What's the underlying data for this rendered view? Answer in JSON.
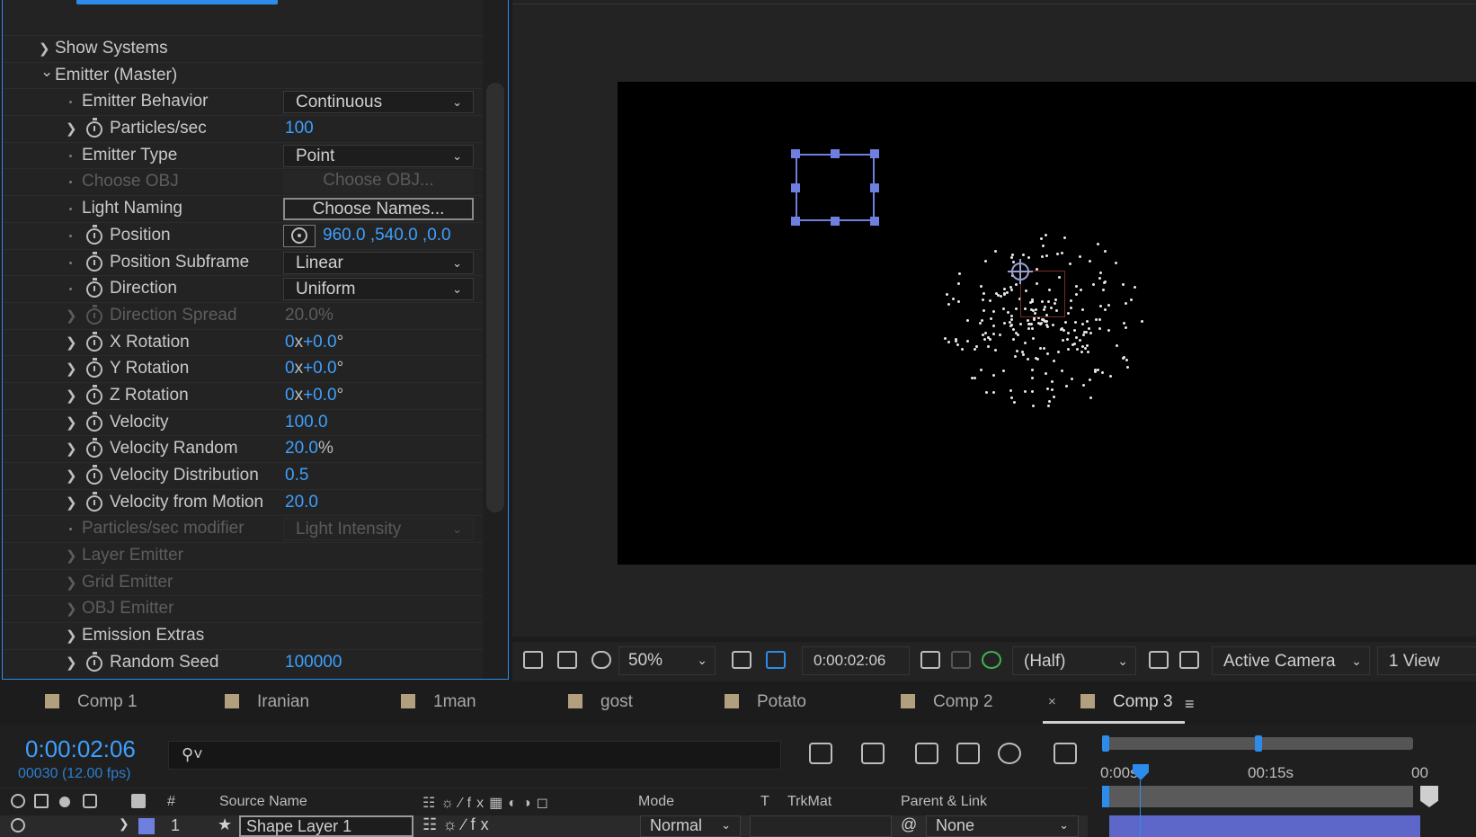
{
  "effect_controls": {
    "rows": [
      {
        "label": "Show Systems",
        "kind": "group",
        "expanded": false
      },
      {
        "label": "Emitter (Master)",
        "kind": "group",
        "expanded": true
      },
      {
        "label": "Emitter Behavior",
        "kind": "dropdown",
        "value": "Continuous"
      },
      {
        "label": "Particles/sec",
        "kind": "value",
        "value": "100",
        "twirl": true,
        "stopwatch": true
      },
      {
        "label": "Emitter Type",
        "kind": "dropdown",
        "value": "Point"
      },
      {
        "label": "Choose OBJ",
        "kind": "button",
        "value": "Choose OBJ...",
        "disabled": true
      },
      {
        "label": "Light Naming",
        "kind": "button",
        "value": "Choose Names..."
      },
      {
        "label": "Position",
        "kind": "point",
        "value": "960.0 ,540.0 ,0.0",
        "stopwatch": true
      },
      {
        "label": "Position Subframe",
        "kind": "dropdown",
        "value": "Linear",
        "stopwatch": true
      },
      {
        "label": "Direction",
        "kind": "dropdown",
        "value": "Uniform",
        "stopwatch": true
      },
      {
        "label": "Direction Spread",
        "kind": "value",
        "value": "20.0",
        "unit": "%",
        "twirl": true,
        "stopwatch": true,
        "disabled": true
      },
      {
        "label": "X Rotation",
        "kind": "rotation",
        "value": "0",
        "value2": "+0.0",
        "twirl": true,
        "stopwatch": true
      },
      {
        "label": "Y Rotation",
        "kind": "rotation",
        "value": "0",
        "value2": "+0.0",
        "twirl": true,
        "stopwatch": true
      },
      {
        "label": "Z Rotation",
        "kind": "rotation",
        "value": "0",
        "value2": "+0.0",
        "twirl": true,
        "stopwatch": true
      },
      {
        "label": "Velocity",
        "kind": "value",
        "value": "100.0",
        "twirl": true,
        "stopwatch": true
      },
      {
        "label": "Velocity Random",
        "kind": "value",
        "value": "20.0",
        "unit": "%",
        "twirl": true,
        "stopwatch": true
      },
      {
        "label": "Velocity Distribution",
        "kind": "value",
        "value": "0.5",
        "twirl": true,
        "stopwatch": true
      },
      {
        "label": "Velocity from Motion",
        "kind": "value",
        "value": "20.0",
        "twirl": true,
        "stopwatch": true
      },
      {
        "label": "Particles/sec modifier",
        "kind": "dropdown",
        "value": "Light Intensity",
        "disabled": true
      },
      {
        "label": "Layer Emitter",
        "kind": "subgroup",
        "disabled": true
      },
      {
        "label": "Grid Emitter",
        "kind": "subgroup",
        "disabled": true
      },
      {
        "label": "OBJ Emitter",
        "kind": "subgroup",
        "disabled": true
      },
      {
        "label": "Emission Extras",
        "kind": "subgroup"
      },
      {
        "label": "Random Seed",
        "kind": "value",
        "value": "100000",
        "twirl": true,
        "stopwatch": true
      }
    ]
  },
  "viewer_toolbar": {
    "zoom": "50%",
    "timecode": "0:00:02:06",
    "resolution": "(Half)",
    "camera": "Active Camera",
    "views": "1 View"
  },
  "tabs": [
    {
      "label": "Comp 1"
    },
    {
      "label": "Iranian"
    },
    {
      "label": "1man"
    },
    {
      "label": "gost"
    },
    {
      "label": "Potato"
    },
    {
      "label": "Comp 2"
    },
    {
      "label": "Comp 3",
      "active": true
    }
  ],
  "timeline": {
    "timecode": "0:00:02:06",
    "frames": "00030 (12.00 fps)",
    "search_placeholder": "",
    "ruler_ticks": [
      "0:00s",
      "00:15s",
      "00"
    ],
    "columns": {
      "number": "#",
      "source_name": "Source Name",
      "mode": "Mode",
      "t": "T",
      "trkmat": "TrkMat",
      "parent": "Parent & Link"
    },
    "layer": {
      "number": "1",
      "name": "Shape Layer 1",
      "mode": "Normal",
      "parent": "None"
    }
  },
  "colors": {
    "accent": "#2d8ceb",
    "value_blue": "#3da0ff",
    "shape_handles": "#6f7fe0",
    "tab_swatch": "#b29f7e",
    "layer_bar": "#5d67c9"
  }
}
